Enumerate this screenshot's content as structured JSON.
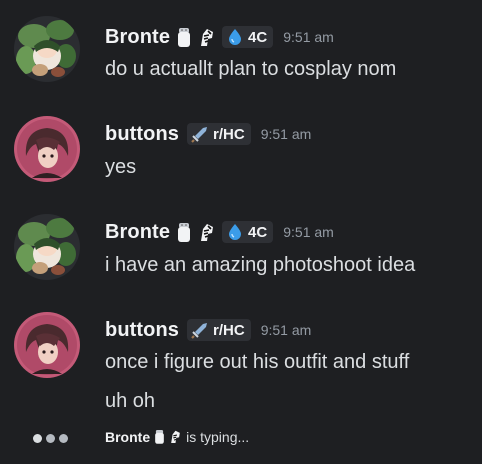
{
  "messages": [
    {
      "username": "Bronte",
      "avatar_icon": "plant-girl-avatar",
      "role_icons": [
        "salt-shaker-icon",
        "zebra-icon"
      ],
      "tag": {
        "icon": "water-drop-icon",
        "label": "4C"
      },
      "time": "9:51 am",
      "lines": [
        "do u actuallt plan to cosplay nom"
      ]
    },
    {
      "username": "buttons",
      "avatar_icon": "red-hair-avatar",
      "role_icons": [],
      "tag": {
        "icon": "sword-icon",
        "label": "r/HC"
      },
      "time": "9:51 am",
      "lines": [
        "yes"
      ]
    },
    {
      "username": "Bronte",
      "avatar_icon": "plant-girl-avatar",
      "role_icons": [
        "salt-shaker-icon",
        "zebra-icon"
      ],
      "tag": {
        "icon": "water-drop-icon",
        "label": "4C"
      },
      "time": "9:51 am",
      "lines": [
        "i have an amazing photoshoot idea"
      ]
    },
    {
      "username": "buttons",
      "avatar_icon": "red-hair-avatar",
      "role_icons": [],
      "tag": {
        "icon": "sword-icon",
        "label": "r/HC"
      },
      "time": "9:51 am",
      "lines": [
        "once i figure out his outfit and stuff",
        "uh oh"
      ]
    }
  ],
  "typing": {
    "name": "Bronte",
    "suffix": "is typing..."
  },
  "colors": {
    "background": "#1e1f22",
    "tag_background": "#2e3035",
    "timestamp": "#949ba4",
    "water_drop": "#3b9ce8",
    "sword": "#8fb3d9"
  }
}
